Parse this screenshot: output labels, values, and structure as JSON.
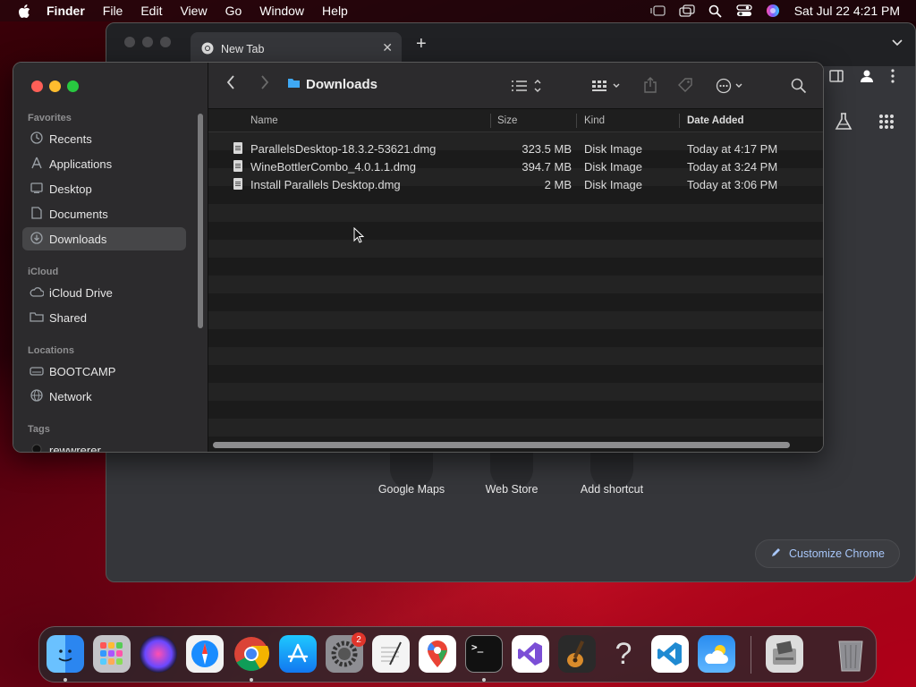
{
  "menubar": {
    "app_name": "Finder",
    "menus": [
      "File",
      "Edit",
      "View",
      "Go",
      "Window",
      "Help"
    ],
    "clock": "Sat Jul 22  4:21 PM"
  },
  "chrome": {
    "tab_title": "New Tab",
    "shortcuts": [
      "Google Maps",
      "Web Store",
      "Add shortcut"
    ],
    "customize_label": "Customize Chrome"
  },
  "finder": {
    "title": "Downloads",
    "sidebar": {
      "favorites_label": "Favorites",
      "favorites": [
        {
          "label": "Recents",
          "icon": "clock-icon"
        },
        {
          "label": "Applications",
          "icon": "applications-icon"
        },
        {
          "label": "Desktop",
          "icon": "desktop-icon"
        },
        {
          "label": "Documents",
          "icon": "document-icon"
        },
        {
          "label": "Downloads",
          "icon": "download-icon",
          "selected": true
        }
      ],
      "icloud_label": "iCloud",
      "icloud": [
        {
          "label": "iCloud Drive",
          "icon": "cloud-icon"
        },
        {
          "label": "Shared",
          "icon": "shared-folder-icon"
        }
      ],
      "locations_label": "Locations",
      "locations": [
        {
          "label": "BOOTCAMP",
          "icon": "drive-icon"
        },
        {
          "label": "Network",
          "icon": "globe-icon"
        }
      ],
      "tags_label": "Tags",
      "tags": [
        {
          "label": "rewwrerer",
          "color": "#1a1a1a"
        }
      ]
    },
    "columns": {
      "name": "Name",
      "size": "Size",
      "kind": "Kind",
      "date": "Date Added"
    },
    "files": [
      {
        "name": "ParallelsDesktop-18.3.2-53621.dmg",
        "size": "323.5 MB",
        "kind": "Disk Image",
        "date": "Today at 4:17 PM"
      },
      {
        "name": "WineBottlerCombo_4.0.1.1.dmg",
        "size": "394.7 MB",
        "kind": "Disk Image",
        "date": "Today at 3:24 PM"
      },
      {
        "name": "Install Parallels Desktop.dmg",
        "size": "2 MB",
        "kind": "Disk Image",
        "date": "Today at 3:06 PM"
      }
    ]
  },
  "dock": {
    "apps": [
      "Finder",
      "Launchpad",
      "Siri",
      "Safari",
      "Google Chrome",
      "App Store",
      "System Settings",
      "TextEdit",
      "Google Maps",
      "Terminal",
      "Visual Studio",
      "GarageBand",
      "Help",
      "Visual Studio Code",
      "Weather",
      "Boot Camp Assistant",
      "Trash"
    ],
    "settings_badge": "2"
  },
  "colors": {
    "accent": "#0a84ff",
    "close": "#ff5f57",
    "minimize": "#febc2e",
    "zoom": "#28c840"
  }
}
